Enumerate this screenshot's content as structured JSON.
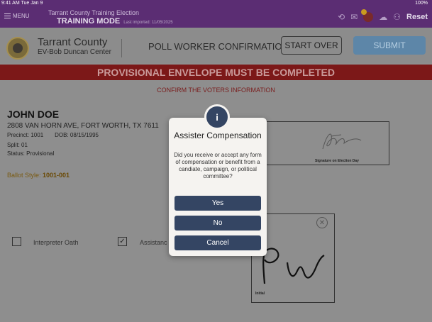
{
  "status_bar": {
    "time": "9:41 AM  Tue Jan 9",
    "battery": "100%"
  },
  "top_bar": {
    "menu_label": "MENU",
    "app_title": "Tarrant County Training Election",
    "mode_label": "TRAINING MODE",
    "last_imported": "Last imported: 11/05/2025",
    "reset_label": "Reset"
  },
  "header": {
    "county": "Tarrant County",
    "location": "EV-Bob Duncan Center",
    "page_title": "POLL WORKER CONFIRMATION",
    "start_over_label": "START OVER",
    "submit_label": "SUBMIT"
  },
  "banner": {
    "text": "PROVISIONAL ENVELOPE MUST BE COMPLETED"
  },
  "confirm_text": "CONFIRM THE VOTERS INFORMATION",
  "voter": {
    "name": "JOHN DOE",
    "address": "2808 VAN HORN AVE, FORT WORTH, TX 7611",
    "precinct": "Precinct: 1001",
    "dob": "DOB: 08/15/1995",
    "split": "Split: 01",
    "status": "Status: Provisional",
    "ballot_style_label": "Ballot Style: ",
    "ballot_style_value": "1001-001"
  },
  "signature": {
    "label": "Signature on Election Day"
  },
  "checkboxes": {
    "interpreter_label": "Interpreter Oath",
    "assistance_label": "Assistanc"
  },
  "initial_box": {
    "label": "Initial"
  },
  "modal": {
    "icon_glyph": "i",
    "title": "Assister Compensation",
    "body": "Did you receive or accept any form of compensation or benefit from a candiate, campaign, or political committee?",
    "yes_label": "Yes",
    "no_label": "No",
    "cancel_label": "Cancel"
  }
}
